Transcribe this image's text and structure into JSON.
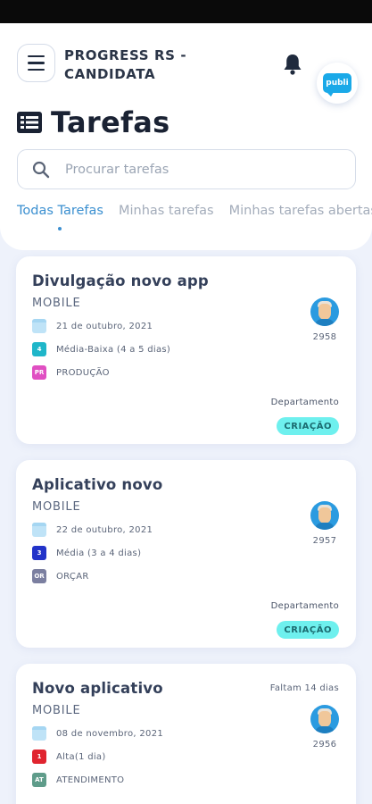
{
  "header": {
    "app_title": "PROGRESS RS - CANDIDATA",
    "page_title": "Tarefas",
    "avatar_logo": "publi"
  },
  "search": {
    "placeholder": "Procurar tarefas"
  },
  "tabs": [
    {
      "label": "Todas Tarefas",
      "active": true
    },
    {
      "label": "Minhas tarefas",
      "active": false
    },
    {
      "label": "Minhas tarefas abertas",
      "active": false
    }
  ],
  "tasks": [
    {
      "title": "Divulgação novo app",
      "category": "MOBILE",
      "date": "21 de outubro, 2021",
      "priority_code": "4",
      "priority_color": "#1fb6c9",
      "priority": "Média-Baixa (4 a 5 dias)",
      "stage_code": "PR",
      "stage_color": "#e04fc2",
      "stage": "PRODUÇÃO",
      "assignee_id": "2958",
      "department_label": "Departamento",
      "department": "CRIAÇÃO",
      "deadline": ""
    },
    {
      "title": "Aplicativo novo",
      "category": "MOBILE",
      "date": "22 de outubro, 2021",
      "priority_code": "3",
      "priority_color": "#2233c9",
      "priority": "Média (3 a 4 dias)",
      "stage_code": "OR",
      "stage_color": "#7b7fa0",
      "stage": "ORÇAR",
      "assignee_id": "2957",
      "department_label": "Departamento",
      "department": "CRIAÇÃO",
      "deadline": ""
    },
    {
      "title": "Novo aplicativo",
      "category": "MOBILE",
      "date": "08 de novembro, 2021",
      "priority_code": "1",
      "priority_color": "#e0242f",
      "priority": "Alta(1 dia)",
      "stage_code": "AT",
      "stage_color": "#5f9c8a",
      "stage": "ATENDIMENTO",
      "assignee_id": "2956",
      "department_label": "",
      "department": "",
      "deadline": "Faltam 14 dias"
    }
  ],
  "colors": {
    "accent": "#3a8fd0",
    "badge": "#6ef0ee",
    "background": "#eef2fb"
  }
}
